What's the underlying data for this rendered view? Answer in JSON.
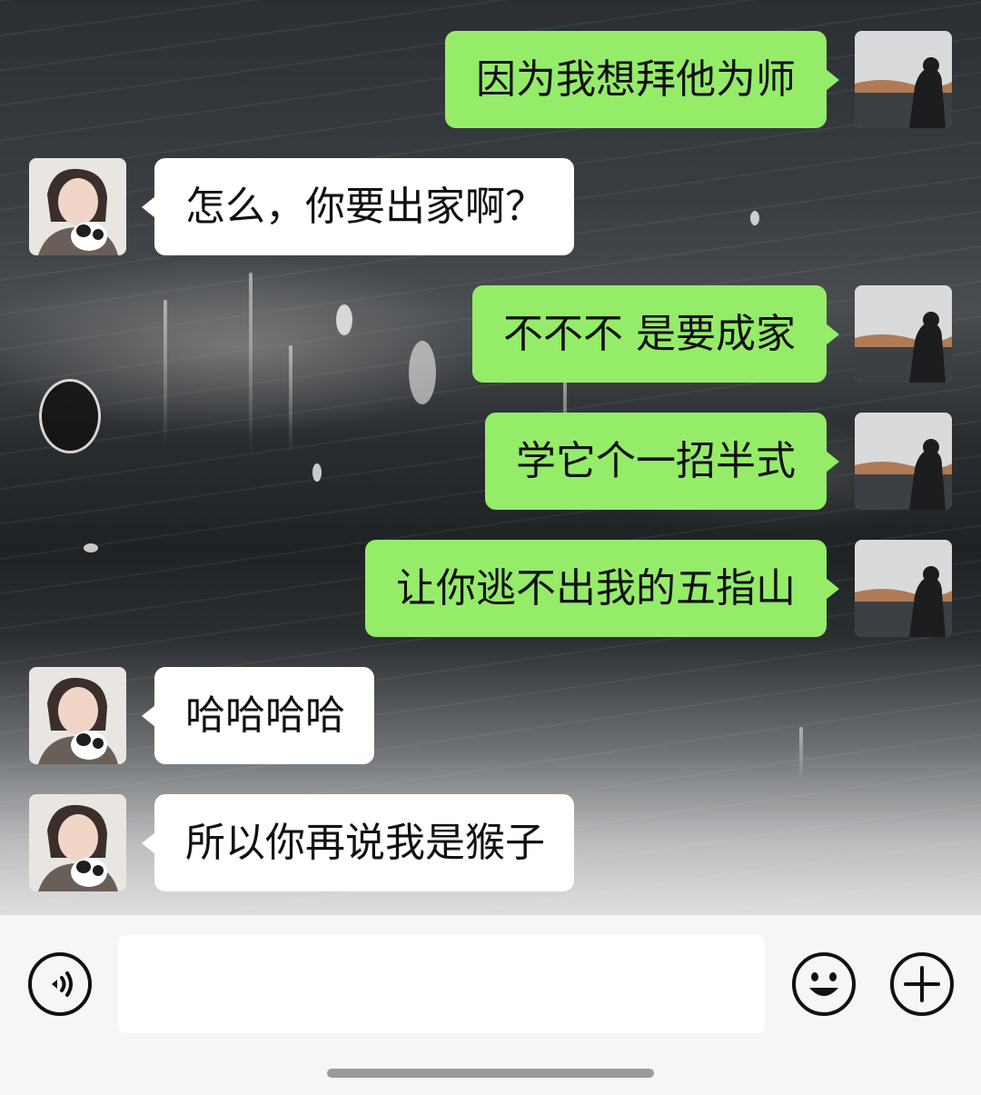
{
  "chat": {
    "messages": [
      {
        "side": "right",
        "text": "因为我想拜他为师"
      },
      {
        "side": "left",
        "text": "怎么，你要出家啊？"
      },
      {
        "side": "right",
        "text": "不不不 是要成家"
      },
      {
        "side": "right",
        "text": "学它个一招半式"
      },
      {
        "side": "right",
        "text": "让你逃不出我的五指山"
      },
      {
        "side": "left",
        "text": "哈哈哈哈"
      },
      {
        "side": "left",
        "text": "所以你再说我是猴子"
      }
    ]
  },
  "input_bar": {
    "voice_icon": "voice-icon",
    "emoji_icon": "emoji-icon",
    "plus_icon": "plus-icon",
    "message_value": ""
  },
  "colors": {
    "sent_bubble": "#95ec69",
    "received_bubble": "#ffffff",
    "input_bar_bg": "#f6f6f6"
  }
}
